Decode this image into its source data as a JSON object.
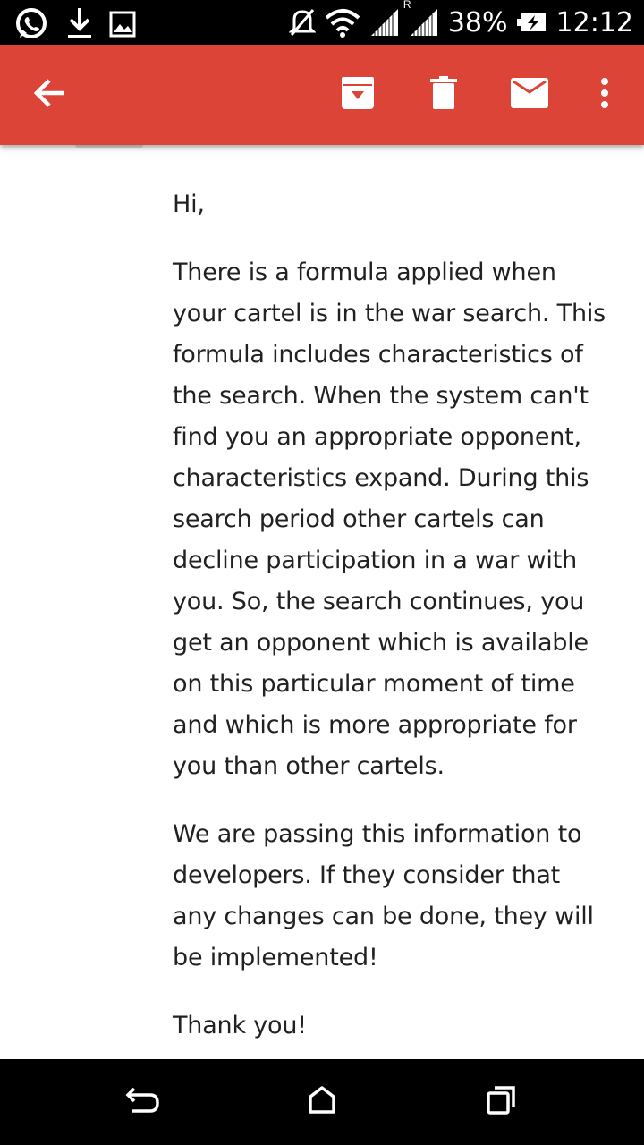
{
  "status_bar": {
    "left_icons": [
      "whatsapp-icon",
      "download-icon",
      "image-icon"
    ],
    "right_icons": [
      "mute-icon",
      "wifi-icon",
      "signal-icon",
      "signal-roaming-icon",
      "battery-charging-icon"
    ],
    "roaming_letter": "R",
    "battery_percent": "38%",
    "time": "12:12"
  },
  "app_bar": {
    "color": "#db4437",
    "icons": [
      "back-arrow-icon",
      "archive-icon",
      "delete-icon",
      "mail-icon",
      "more-vert-icon"
    ]
  },
  "email": {
    "greeting": "Hi,",
    "paragraphs": [
      "There is a formula applied when your cartel is in the war search. This formula includes characteristics of the search. When the system can't find you an appropriate opponent, characteristics expand. During this search period other cartels can decline participation in a war with you. So, the search continues, you get an opponent which is available on this particular moment of time and which is more appropriate for you than other cartels.",
      "We are passing this information to developers. If they consider that any changes can be done, they will be implemented!",
      "Thank you!"
    ]
  },
  "nav_bar": {
    "icons": [
      "back-nav-icon",
      "home-nav-icon",
      "recents-nav-icon"
    ]
  }
}
